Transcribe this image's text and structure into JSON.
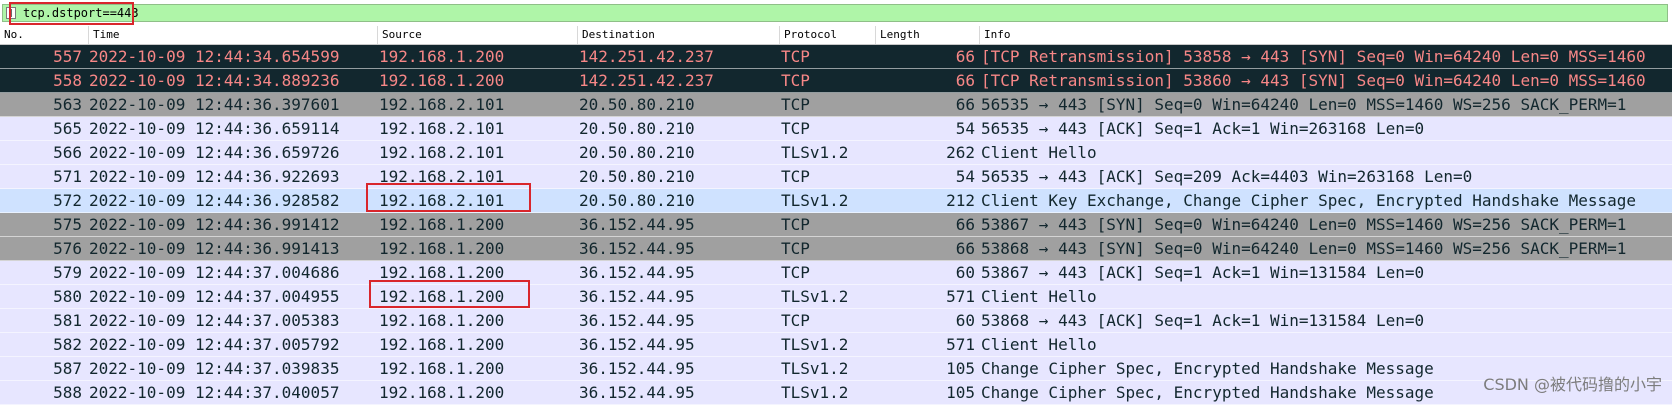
{
  "filter": {
    "text": "tcp.dstport==443"
  },
  "columns": {
    "no": "No.",
    "time": "Time",
    "source": "Source",
    "destination": "Destination",
    "protocol": "Protocol",
    "length": "Length",
    "info": "Info"
  },
  "rows": [
    {
      "no": "557",
      "time": "2022-10-09 12:44:34.654599",
      "src": "192.168.1.200",
      "dst": "142.251.42.237",
      "proto": "TCP",
      "len": "66",
      "info": "[TCP Retransmission] 53858 → 443 [SYN] Seq=0 Win=64240 Len=0 MSS=1460"
    },
    {
      "no": "558",
      "time": "2022-10-09 12:44:34.889236",
      "src": "192.168.1.200",
      "dst": "142.251.42.237",
      "proto": "TCP",
      "len": "66",
      "info": "[TCP Retransmission] 53860 → 443 [SYN] Seq=0 Win=64240 Len=0 MSS=1460"
    },
    {
      "no": "563",
      "time": "2022-10-09 12:44:36.397601",
      "src": "192.168.2.101",
      "dst": "20.50.80.210",
      "proto": "TCP",
      "len": "66",
      "info": "56535 → 443 [SYN] Seq=0 Win=64240 Len=0 MSS=1460 WS=256 SACK_PERM=1"
    },
    {
      "no": "565",
      "time": "2022-10-09 12:44:36.659114",
      "src": "192.168.2.101",
      "dst": "20.50.80.210",
      "proto": "TCP",
      "len": "54",
      "info": "56535 → 443 [ACK] Seq=1 Ack=1 Win=263168 Len=0"
    },
    {
      "no": "566",
      "time": "2022-10-09 12:44:36.659726",
      "src": "192.168.2.101",
      "dst": "20.50.80.210",
      "proto": "TLSv1.2",
      "len": "262",
      "info": "Client Hello"
    },
    {
      "no": "571",
      "time": "2022-10-09 12:44:36.922693",
      "src": "192.168.2.101",
      "dst": "20.50.80.210",
      "proto": "TCP",
      "len": "54",
      "info": "56535 → 443 [ACK] Seq=209 Ack=4403 Win=263168 Len=0"
    },
    {
      "no": "572",
      "time": "2022-10-09 12:44:36.928582",
      "src": "192.168.2.101",
      "dst": "20.50.80.210",
      "proto": "TLSv1.2",
      "len": "212",
      "info": "Client Key Exchange, Change Cipher Spec, Encrypted Handshake Message"
    },
    {
      "no": "575",
      "time": "2022-10-09 12:44:36.991412",
      "src": "192.168.1.200",
      "dst": "36.152.44.95",
      "proto": "TCP",
      "len": "66",
      "info": "53867 → 443 [SYN] Seq=0 Win=64240 Len=0 MSS=1460 WS=256 SACK_PERM=1"
    },
    {
      "no": "576",
      "time": "2022-10-09 12:44:36.991413",
      "src": "192.168.1.200",
      "dst": "36.152.44.95",
      "proto": "TCP",
      "len": "66",
      "info": "53868 → 443 [SYN] Seq=0 Win=64240 Len=0 MSS=1460 WS=256 SACK_PERM=1"
    },
    {
      "no": "579",
      "time": "2022-10-09 12:44:37.004686",
      "src": "192.168.1.200",
      "dst": "36.152.44.95",
      "proto": "TCP",
      "len": "60",
      "info": "53867 → 443 [ACK] Seq=1 Ack=1 Win=131584 Len=0"
    },
    {
      "no": "580",
      "time": "2022-10-09 12:44:37.004955",
      "src": "192.168.1.200",
      "dst": "36.152.44.95",
      "proto": "TLSv1.2",
      "len": "571",
      "info": "Client Hello"
    },
    {
      "no": "581",
      "time": "2022-10-09 12:44:37.005383",
      "src": "192.168.1.200",
      "dst": "36.152.44.95",
      "proto": "TCP",
      "len": "60",
      "info": "53868 → 443 [ACK] Seq=1 Ack=1 Win=131584 Len=0"
    },
    {
      "no": "582",
      "time": "2022-10-09 12:44:37.005792",
      "src": "192.168.1.200",
      "dst": "36.152.44.95",
      "proto": "TLSv1.2",
      "len": "571",
      "info": "Client Hello"
    },
    {
      "no": "587",
      "time": "2022-10-09 12:44:37.039835",
      "src": "192.168.1.200",
      "dst": "36.152.44.95",
      "proto": "TLSv1.2",
      "len": "105",
      "info": "Change Cipher Spec, Encrypted Handshake Message"
    },
    {
      "no": "588",
      "time": "2022-10-09 12:44:37.040057",
      "src": "192.168.1.200",
      "dst": "36.152.44.95",
      "proto": "TLSv1.2",
      "len": "105",
      "info": "Change Cipher Spec, Encrypted Handshake Message"
    }
  ],
  "colors": {
    "dark_row_bg": "#12272e",
    "dark_row_text": "#f78787",
    "gray_row_bg": "#a0a0a0",
    "lavender_row_bg": "#e7e6ff",
    "selected_row_bg": "#cfe2ff",
    "filter_bg": "#aff5a8",
    "annotation": "#d9262c"
  },
  "watermark": "CSDN @被代码撸的小宇"
}
